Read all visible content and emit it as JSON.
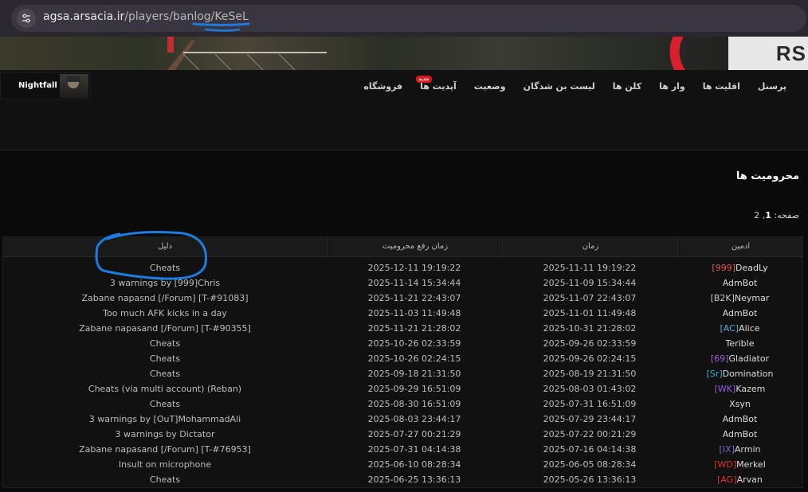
{
  "browser": {
    "url_host": "agsa.arsacia.ir",
    "url_path": "/players/banlog/KeSeL"
  },
  "banner": {
    "logo_text": "RS"
  },
  "nav": {
    "username": "Nightfall",
    "menu": [
      "پرسنل",
      "اقلیت ها",
      "وار ها",
      "کلن ها",
      "لیست بن شدگان",
      "وضعیت",
      "آپدیت ها",
      "فروشگاه"
    ],
    "new_badge": "جدید"
  },
  "content": {
    "title": "محرومیت ها",
    "pages_label": "صفحه:",
    "pages_current": "1",
    "pages_sep": ",",
    "pages_other": "2"
  },
  "table": {
    "headers": {
      "admin": "ادمین",
      "time": "زمان",
      "unban": "زمان رفع محرومیت",
      "reason": "دلیل"
    },
    "rows": [
      {
        "tag": "[999]",
        "tag_color": "#e05a4a",
        "name": "DeadLy",
        "time": "2025-11-11 19:19:22",
        "unban": "2025-12-11 19:19:22",
        "reason": "Cheats"
      },
      {
        "tag": "",
        "tag_color": "",
        "name": "AdmBot",
        "time": "2025-11-09 15:34:44",
        "unban": "2025-11-14 15:34:44",
        "reason": "3 warnings by [999]Chris"
      },
      {
        "tag": "[B2K]",
        "tag_color": "#c9c9c9",
        "name": "Neymar",
        "time": "2025-11-07 22:43:07",
        "unban": "2025-11-21 22:43:07",
        "reason": "Zabane napasnd [/Forum] [T-#91083]"
      },
      {
        "tag": "",
        "tag_color": "",
        "name": "AdmBot",
        "time": "2025-11-01 11:49:48",
        "unban": "2025-11-03 11:49:48",
        "reason": "Too much AFK kicks in a day"
      },
      {
        "tag": "[AC]",
        "tag_color": "#4fb0e0",
        "name": "Alice",
        "time": "2025-10-31 21:28:02",
        "unban": "2025-11-21 21:28:02",
        "reason": "Zabane napasand [/Forum] [T-#90355]"
      },
      {
        "tag": "",
        "tag_color": "",
        "name": "Terible",
        "time": "2025-09-26 02:33:59",
        "unban": "2025-10-26 02:33:59",
        "reason": "Cheats"
      },
      {
        "tag": "[69]",
        "tag_color": "#a060e0",
        "name": "Gladiator",
        "time": "2025-09-26 02:24:15",
        "unban": "2025-10-26 02:24:15",
        "reason": "Cheats"
      },
      {
        "tag": "[Sr]",
        "tag_color": "#3ab0d0",
        "name": "Domination",
        "time": "2025-08-19 21:31:50",
        "unban": "2025-09-18 21:31:50",
        "reason": "Cheats"
      },
      {
        "tag": "[WK]",
        "tag_color": "#9a5ae0",
        "name": "Kazem",
        "time": "2025-08-03 01:43:02",
        "unban": "2025-09-29 16:51:09",
        "reason": "Cheats (via multi account) (Reban)"
      },
      {
        "tag": "",
        "tag_color": "",
        "name": "Xsyn",
        "time": "2025-07-31 16:51:09",
        "unban": "2025-08-30 16:51:09",
        "reason": "Cheats"
      },
      {
        "tag": "",
        "tag_color": "",
        "name": "AdmBot",
        "time": "2025-07-29 23:44:17",
        "unban": "2025-08-03 23:44:17",
        "reason": "3 warnings by [OuT]MohammadAli"
      },
      {
        "tag": "",
        "tag_color": "",
        "name": "AdmBot",
        "time": "2025-07-22 00:21:29",
        "unban": "2025-07-27 00:21:29",
        "reason": "3 warnings by Dictator"
      },
      {
        "tag": "[IX]",
        "tag_color": "#7070d0",
        "name": "Armin",
        "time": "2025-07-16 04:14:38",
        "unban": "2025-07-31 04:14:38",
        "reason": "Zabane napasand [/Forum] [T-#76953]"
      },
      {
        "tag": "[WD]",
        "tag_color": "#e03030",
        "name": "Merkel",
        "time": "2025-06-05 08:28:34",
        "unban": "2025-06-10 08:28:34",
        "reason": "Insult on microphone"
      },
      {
        "tag": "[AG]",
        "tag_color": "#e03030",
        "name": "Arvan",
        "time": "2025-05-26 13:36:13",
        "unban": "2025-06-25 13:36:13",
        "reason": "Cheats"
      }
    ]
  },
  "colors": {
    "accent_red": "#d71a1a",
    "scribble_blue": "#1e7ce0"
  },
  "icons": {
    "site_info": "tune-icon"
  }
}
